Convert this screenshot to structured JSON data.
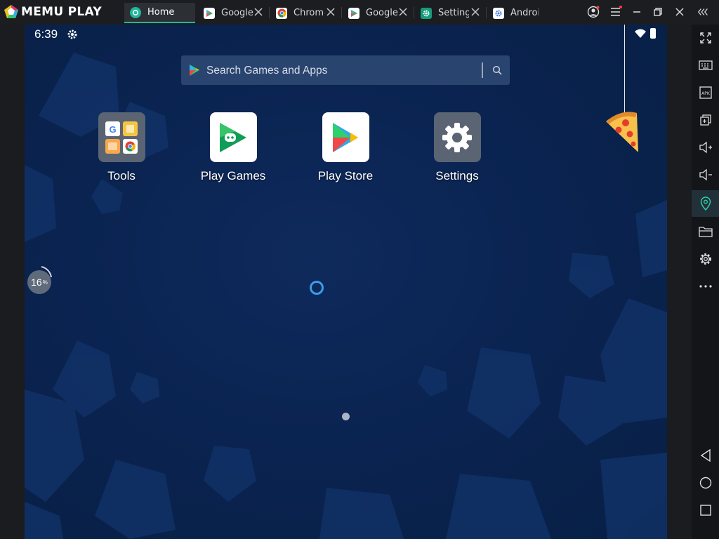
{
  "app": {
    "name": "MEMU PLAY"
  },
  "tabs": [
    {
      "label": "Home",
      "icon": "memu-home-icon",
      "active": true
    },
    {
      "label": "Google",
      "icon": "play-store-icon"
    },
    {
      "label": "Chrome",
      "icon": "chrome-icon"
    },
    {
      "label": "Google",
      "icon": "play-store-icon"
    },
    {
      "label": "Setting",
      "icon": "settings-app-icon"
    },
    {
      "label": "Androic",
      "icon": "android-settings-icon"
    }
  ],
  "status": {
    "time": "6:39"
  },
  "search": {
    "placeholder": "Search Games and Apps"
  },
  "apps": [
    {
      "label": "Tools",
      "icon": "tools-folder-icon"
    },
    {
      "label": "Play Games",
      "icon": "play-games-icon"
    },
    {
      "label": "Play Store",
      "icon": "play-store-icon"
    },
    {
      "label": "Settings",
      "icon": "settings-gear-icon"
    }
  ],
  "performance": {
    "value": "16",
    "unit": "%"
  },
  "sidebar": [
    "fullscreen-icon",
    "keyboard-icon",
    "apk-icon",
    "multi-instance-icon",
    "volume-up-icon",
    "volume-down-icon",
    "location-icon",
    "folder-icon",
    "settings-icon",
    "more-icon",
    "back-icon",
    "home-icon",
    "recents-icon"
  ],
  "colors": {
    "accent": "#1fb89a",
    "wallpaper": "#0a2350",
    "location_active": "#2bd1a5"
  }
}
